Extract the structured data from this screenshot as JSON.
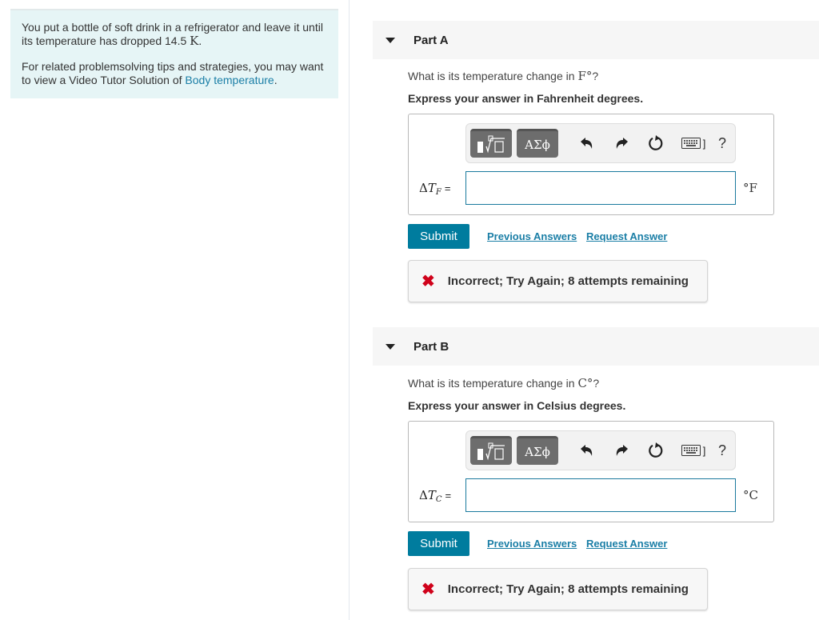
{
  "intro": {
    "text_before": "You put a bottle of soft drink in a refrigerator and leave it until its temperature has dropped 14.5 ",
    "unit": "K",
    "text_after": ".",
    "tips_before": "For related problemsolving tips and strategies, you may want to view a Video Tutor Solution of ",
    "tips_link": "Body temperature",
    "tips_after": "."
  },
  "toolbar": {
    "templates_icon": "templates-icon",
    "greek_label": "ΑΣϕ",
    "undo_icon": "undo-icon",
    "redo_icon": "redo-icon",
    "reset_icon": "reset-icon",
    "keyboard_icon": "keyboard-icon",
    "keyboard_bracket": "]",
    "help_label": "?"
  },
  "parts": [
    {
      "title": "Part A",
      "question_before": "What is its temperature change in ",
      "question_unit": "F°",
      "question_after": "?",
      "instruction": "Express your answer in Fahrenheit degrees.",
      "label_delta": "Δ",
      "label_var": "T",
      "label_sub": "F",
      "label_eq": "=",
      "input_value": "",
      "unit": "°F",
      "submit_label": "Submit",
      "previous_answers_label": "Previous Answers",
      "request_answer_label": "Request Answer",
      "feedback": "Incorrect; Try Again; 8 attempts remaining"
    },
    {
      "title": "Part B",
      "question_before": "What is its temperature change in ",
      "question_unit": "C°",
      "question_after": "?",
      "instruction": "Express your answer in Celsius degrees.",
      "label_delta": "Δ",
      "label_var": "T",
      "label_sub": "C",
      "label_eq": "=",
      "input_value": "",
      "unit": "°C",
      "submit_label": "Submit",
      "previous_answers_label": "Previous Answers",
      "request_answer_label": "Request Answer",
      "feedback": "Incorrect; Try Again; 8 attempts remaining"
    }
  ],
  "colors": {
    "accent": "#007c9e",
    "link": "#1a7ea6",
    "error": "#d0021b",
    "intro_bg": "#e6f5f6"
  }
}
